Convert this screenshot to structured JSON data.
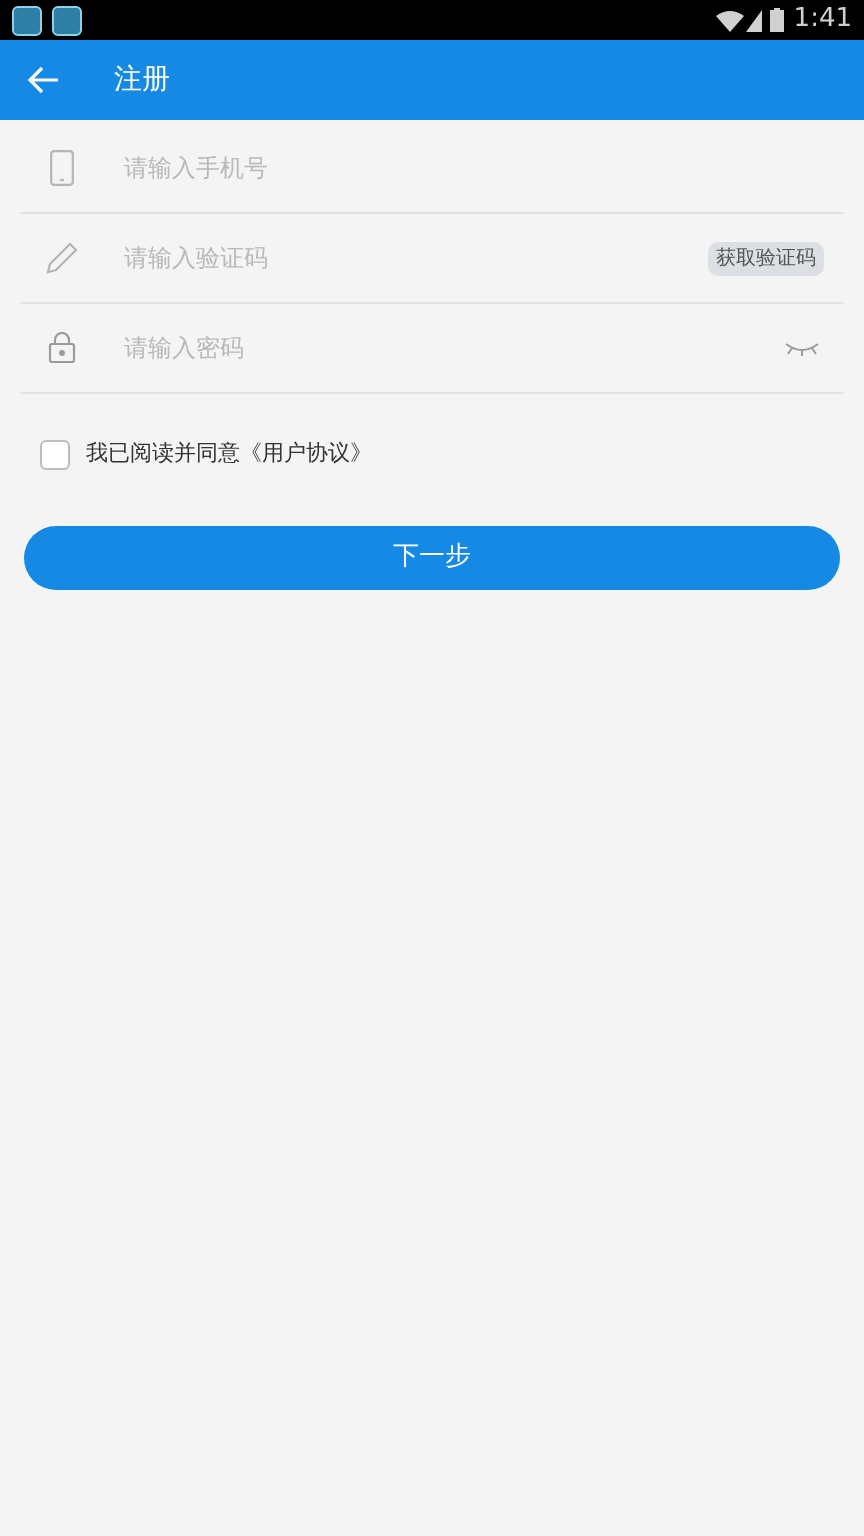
{
  "status_bar": {
    "time": "1:41"
  },
  "header": {
    "title": "注册"
  },
  "fields": [
    {
      "kind": "phone",
      "placeholder": "请输入手机号"
    },
    {
      "kind": "code",
      "placeholder": "请输入验证码",
      "action": "获取验证码"
    },
    {
      "kind": "password",
      "placeholder": "请输入密码",
      "revealed": false
    }
  ],
  "agreement": {
    "text": "我已阅读并同意《用户协议》",
    "checked": false
  },
  "next_button": "下一步"
}
